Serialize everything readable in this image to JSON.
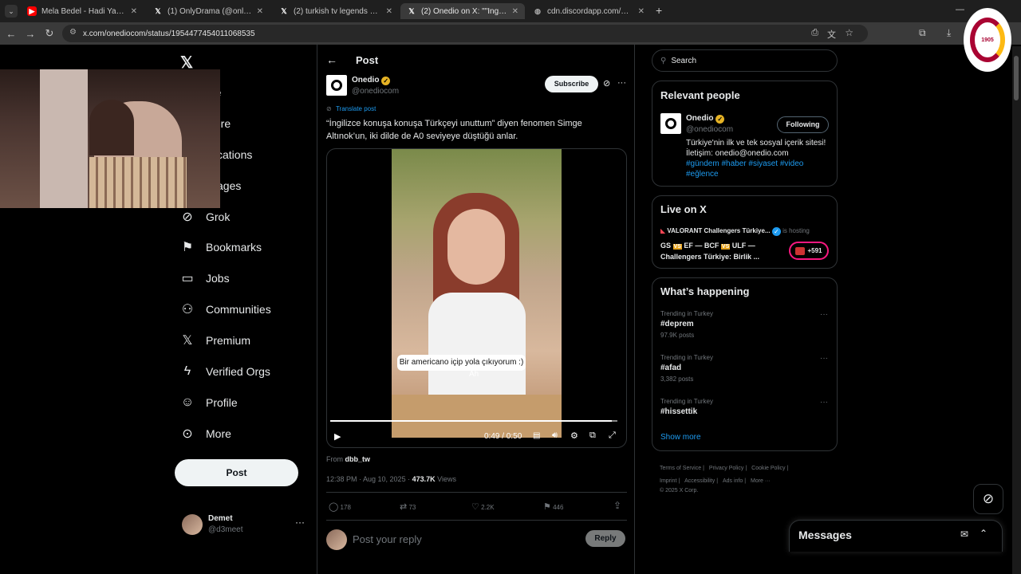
{
  "browser": {
    "tabs": [
      {
        "title": "Mela Bedel - Hadi Yallah (Offici",
        "icon": "youtube-icon"
      },
      {
        "title": "(1) OnlyDrama (@onlydramaX)",
        "icon": "x-logo-icon"
      },
      {
        "title": "(2) turkish tv legends on X: \"Bu",
        "icon": "x-logo-icon"
      },
      {
        "title": "(2) Onedio on X: \"\"İngilizce kon",
        "icon": "x-logo-icon"
      },
      {
        "title": "cdn.discordapp.com/attachmen",
        "icon": "globe-icon"
      }
    ],
    "url": "x.com/onediocom/status/1954477454011068535"
  },
  "nav": {
    "items": [
      {
        "label": "Home",
        "visible": "me",
        "icon": "home-icon"
      },
      {
        "label": "Explore",
        "visible": "plore",
        "icon": "search-icon"
      },
      {
        "label": "Notifications",
        "visible": "tifications",
        "icon": "bell-icon"
      },
      {
        "label": "Messages",
        "visible": "ssages",
        "icon": "envelope-icon"
      },
      {
        "label": "Grok",
        "visible": "Grok",
        "icon": "grok-icon"
      },
      {
        "label": "Bookmarks",
        "visible": "Bookmarks",
        "icon": "bookmark-icon"
      },
      {
        "label": "Jobs",
        "visible": "Jobs",
        "icon": "briefcase-icon"
      },
      {
        "label": "Communities",
        "visible": "Communities",
        "icon": "people-icon"
      },
      {
        "label": "Premium",
        "visible": "Premium",
        "icon": "x-logo-icon"
      },
      {
        "label": "Verified Orgs",
        "visible": "Verified Orgs",
        "icon": "lightning-icon"
      },
      {
        "label": "Profile",
        "visible": "Profile",
        "icon": "person-icon"
      },
      {
        "label": "More",
        "visible": "More",
        "icon": "more-circle-icon"
      }
    ],
    "post_label": "Post",
    "account": {
      "name": "Demet",
      "handle": "@d3meet"
    }
  },
  "post": {
    "header_title": "Post",
    "author_name": "Onedio",
    "author_handle": "@onediocom",
    "subscribe_label": "Subscribe",
    "translate_label": "Translate post",
    "text": "“İngilizce konuşa konuşa Türkçeyi unuttum” diyen fenomen Simge Altınok’un, iki dilde de A0 seviyeye düştüğü anlar.",
    "video": {
      "caption": "Bir americano içip yola çıkıyorum :)",
      "subcaption": "Ah",
      "time": "0:49 / 0:50",
      "progress": 0.98
    },
    "from_label": "From",
    "from_user": "dbb_tw",
    "timestamp": "12:38 PM · Aug 10, 2025 · ",
    "views_count": "473.7K",
    "views_label": " Views",
    "stats": {
      "replies": "178",
      "reposts": "73",
      "likes": "2.2K",
      "bookmarks": "446"
    },
    "reply_placeholder": "Post your reply",
    "reply_button": "Reply"
  },
  "right": {
    "search_placeholder": "Search",
    "relevant": {
      "title": "Relevant people",
      "name": "Onedio",
      "handle": "@onediocom",
      "follow_label": "Following",
      "bio": "Türkiye'nin ilk ve tek sosyal içerik sitesi! İletişim: onedio@onedio.com",
      "hashtags": "#gündem #haber #siyaset #video #eğlence"
    },
    "live": {
      "title": "Live on X",
      "host": "VALORANT Challengers Türkiye...",
      "hosting_label": "is hosting",
      "line1_a": "GS",
      "vs1": "VS",
      "line1_b": "EF — BCF",
      "vs2": "VS",
      "line1_c": "ULF —",
      "line2": "Challengers Türkiye: Birlik ...",
      "listeners": "+591"
    },
    "happening": {
      "title": "What’s happening",
      "trends": [
        {
          "meta": "Trending in Turkey",
          "name": "#deprem",
          "count": "97.9K posts"
        },
        {
          "meta": "Trending in Turkey",
          "name": "#afad",
          "count": "3,382 posts"
        },
        {
          "meta": "Trending in Turkey",
          "name": "#hissettik",
          "count": ""
        }
      ],
      "show_more": "Show more"
    },
    "footer": {
      "links": [
        "Terms of Service",
        "Privacy Policy",
        "Cookie Policy",
        "Imprint",
        "Accessibility",
        "Ads info",
        "More ···"
      ],
      "copyright": "© 2025 X Corp."
    }
  },
  "messages_drawer": {
    "title": "Messages"
  },
  "badge": {
    "text": "1905"
  },
  "colors": {
    "accent": "#1d9bf0",
    "gold": "#e6b325",
    "badge_red": "#a90432",
    "badge_yellow": "#fdb912"
  }
}
